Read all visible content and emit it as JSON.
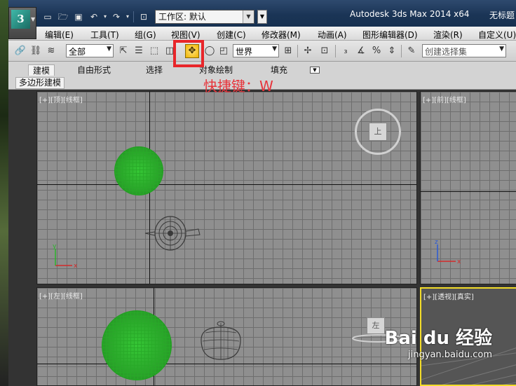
{
  "titlebar": {
    "app_title": "Autodesk 3ds Max  2014 x64",
    "doc_title": "无标题",
    "logo_letter": "3",
    "workspace_label": "工作区: 默认"
  },
  "menus": [
    "编辑(E)",
    "工具(T)",
    "组(G)",
    "视图(V)",
    "创建(C)",
    "修改器(M)",
    "动画(A)",
    "图形编辑器(D)",
    "渲染(R)",
    "自定义(U)"
  ],
  "toolbar": {
    "selection_filter": "全部",
    "reference_coord": "世界",
    "named_selection_placeholder": "创建选择集"
  },
  "ribbon": {
    "tabs": [
      "建模",
      "自由形式",
      "选择",
      "对象绘制",
      "填充"
    ],
    "active_tab": "建模",
    "panel_label": "多边形建模"
  },
  "annotation": {
    "shortcut": "快捷键：W"
  },
  "viewports": {
    "top": {
      "label": "[+][顶][线框]",
      "cube_label": "上"
    },
    "front": {
      "label": "[+][前][线框]"
    },
    "left": {
      "label": "[+][左][线框]",
      "cube_label": "左"
    },
    "perspective": {
      "label": "[+][透视][真实]"
    }
  },
  "watermark": {
    "logo": "Bai du 经验",
    "url": "jingyan.baidu.com"
  },
  "colors": {
    "highlight": "#e8262a",
    "object": "#2aa32a",
    "active_viewport": "#f3dd2a",
    "shortcut_text": "#e7343b"
  }
}
